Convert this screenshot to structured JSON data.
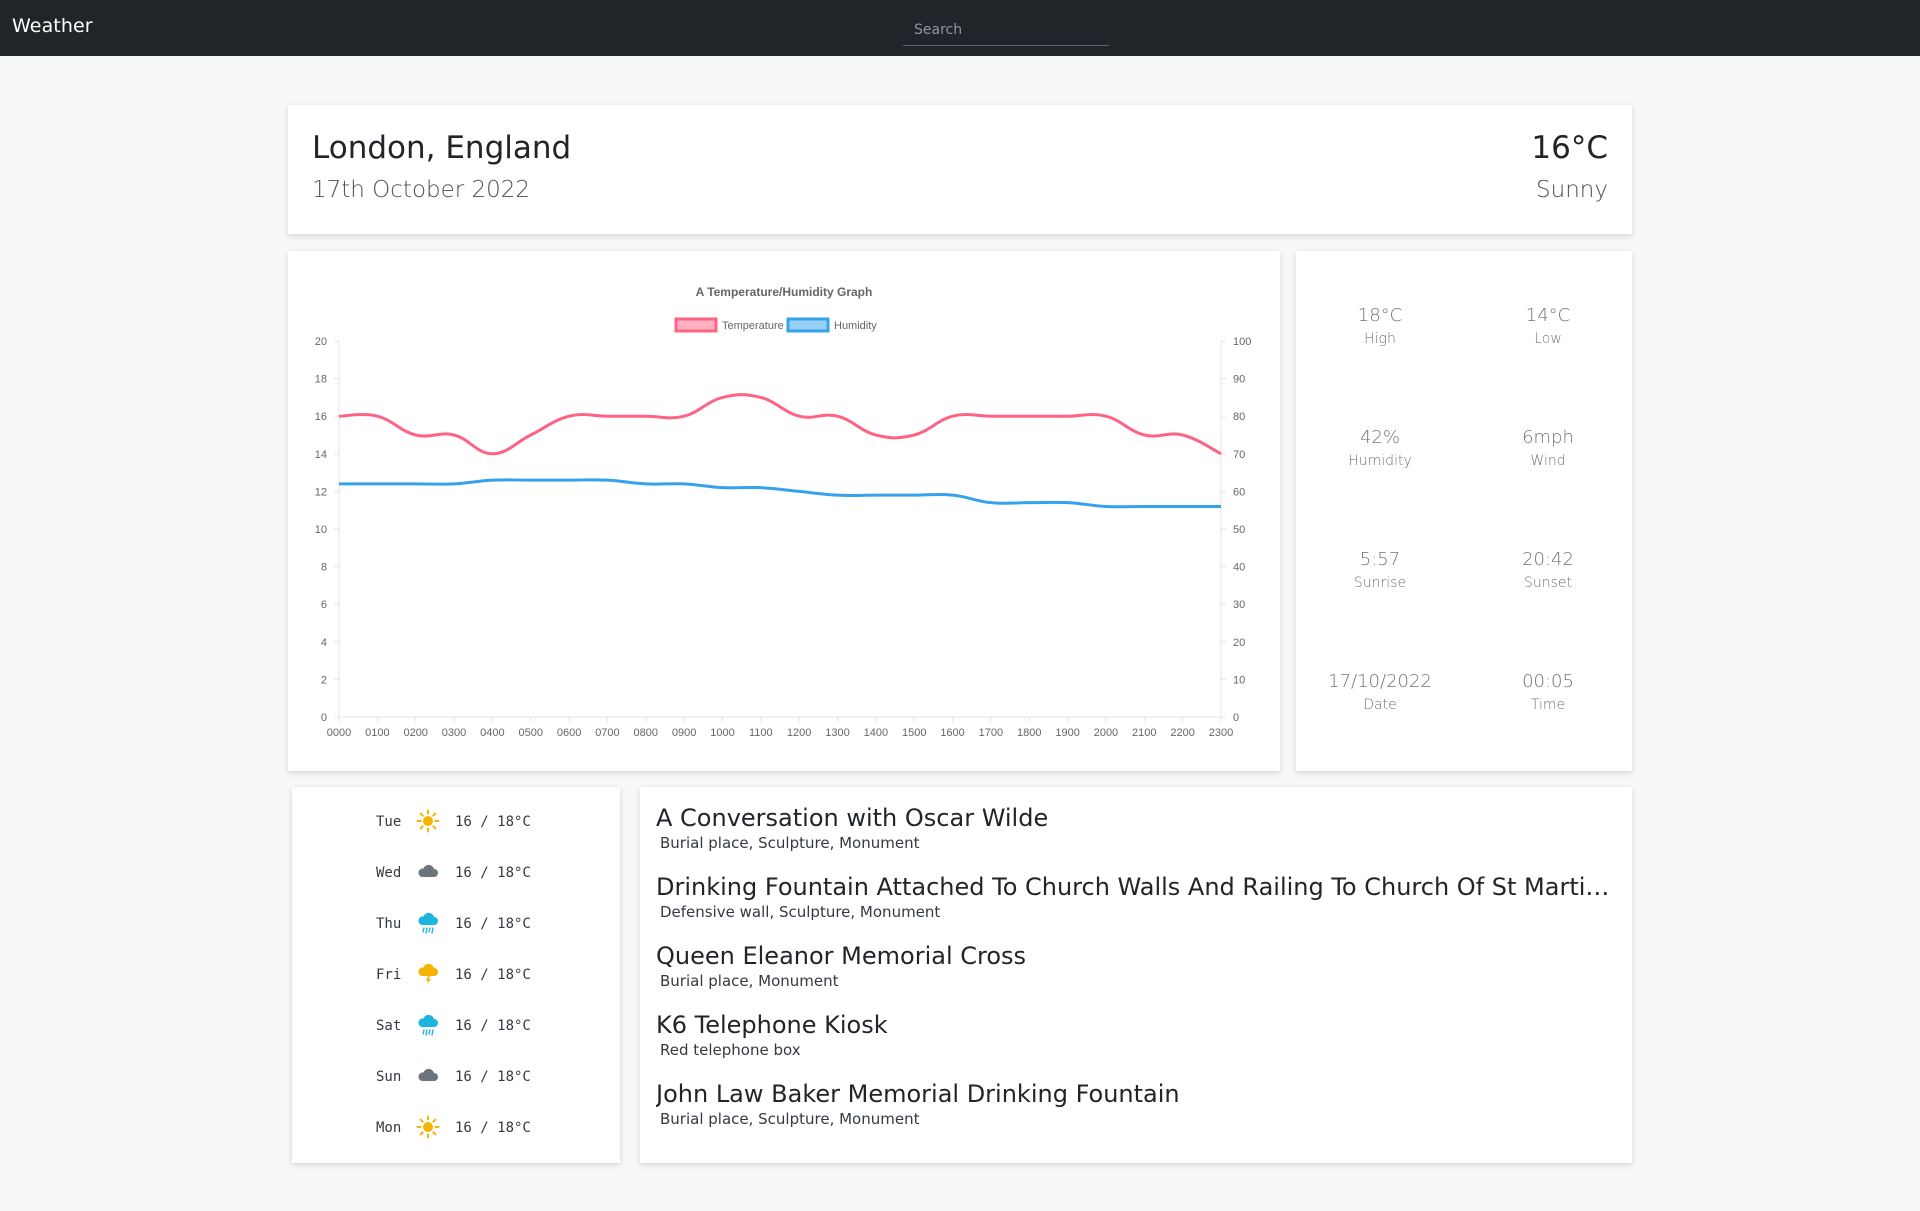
{
  "navbar": {
    "brand": "Weather",
    "search_placeholder": "Search"
  },
  "current": {
    "location": "London, England",
    "date": "17th October 2022",
    "temperature": "16°C",
    "condition": "Sunny"
  },
  "stats": [
    {
      "value": "18°C",
      "label": "High"
    },
    {
      "value": "14°C",
      "label": "Low"
    },
    {
      "value": "42%",
      "label": "Humidity"
    },
    {
      "value": "6mph",
      "label": "Wind"
    },
    {
      "value": "5:57",
      "label": "Sunrise"
    },
    {
      "value": "20:42",
      "label": "Sunset"
    },
    {
      "value": "17/10/2022",
      "label": "Date"
    },
    {
      "value": "00:05",
      "label": "Time"
    }
  ],
  "forecast": [
    {
      "day": "Tue",
      "icon": "sun-icon",
      "temps": "16 / 18°C"
    },
    {
      "day": "Wed",
      "icon": "cloud-icon",
      "temps": "16 / 18°C"
    },
    {
      "day": "Thu",
      "icon": "rain-icon",
      "temps": "16 / 18°C"
    },
    {
      "day": "Fri",
      "icon": "thunderstorm-icon",
      "temps": "16 / 18°C"
    },
    {
      "day": "Sat",
      "icon": "rain-icon",
      "temps": "16 / 18°C"
    },
    {
      "day": "Sun",
      "icon": "cloud-icon",
      "temps": "16 / 18°C"
    },
    {
      "day": "Mon",
      "icon": "sun-icon",
      "temps": "16 / 18°C"
    }
  ],
  "landmarks": [
    {
      "name": "A Conversation with Oscar Wilde",
      "tags": "Burial place, Sculpture, Monument"
    },
    {
      "name": "Drinking Fountain Attached To Church Walls And Railing To Church Of St Martin In The Fields",
      "tags": "Defensive wall, Sculpture, Monument"
    },
    {
      "name": "Queen Eleanor Memorial Cross",
      "tags": "Burial place, Monument"
    },
    {
      "name": "K6 Telephone Kiosk",
      "tags": "Red telephone box"
    },
    {
      "name": "John Law Baker Memorial Drinking Fountain",
      "tags": "Burial place, Sculpture, Monument"
    }
  ],
  "colors": {
    "temperature": "#ff6384",
    "humidity": "#36a2eb",
    "sun": "#f5b400",
    "cloud": "#6c757d",
    "rain": "#1cb5e0"
  },
  "chart_data": {
    "type": "line",
    "title": "A Temperature/Humidity Graph",
    "categories": [
      "0000",
      "0100",
      "0200",
      "0300",
      "0400",
      "0500",
      "0600",
      "0700",
      "0800",
      "0900",
      "1000",
      "1100",
      "1200",
      "1300",
      "1400",
      "1500",
      "1600",
      "1700",
      "1800",
      "1900",
      "2000",
      "2100",
      "2200",
      "2300"
    ],
    "series": [
      {
        "name": "Temperature",
        "axis": "left",
        "values": [
          16,
          16,
          15,
          15,
          14,
          15,
          16,
          16,
          16,
          16,
          17,
          17,
          16,
          16,
          15,
          15,
          16,
          16,
          16,
          16,
          16,
          15,
          15,
          14
        ]
      },
      {
        "name": "Humidity",
        "axis": "right",
        "values": [
          62,
          62,
          62,
          62,
          63,
          63,
          63,
          63,
          62,
          62,
          61,
          61,
          60,
          59,
          59,
          59,
          59,
          57,
          57,
          57,
          56,
          56,
          56,
          56
        ]
      }
    ],
    "y_left": {
      "min": 0,
      "max": 20,
      "ticks": [
        "0",
        "2",
        "4",
        "6",
        "8",
        "10",
        "12",
        "14",
        "16",
        "18",
        "20"
      ]
    },
    "y_right": {
      "min": 0,
      "max": 100,
      "ticks": [
        "0",
        "10",
        "20",
        "30",
        "40",
        "50",
        "60",
        "70",
        "80",
        "90",
        "100"
      ]
    },
    "legend": "top",
    "grid": false
  }
}
